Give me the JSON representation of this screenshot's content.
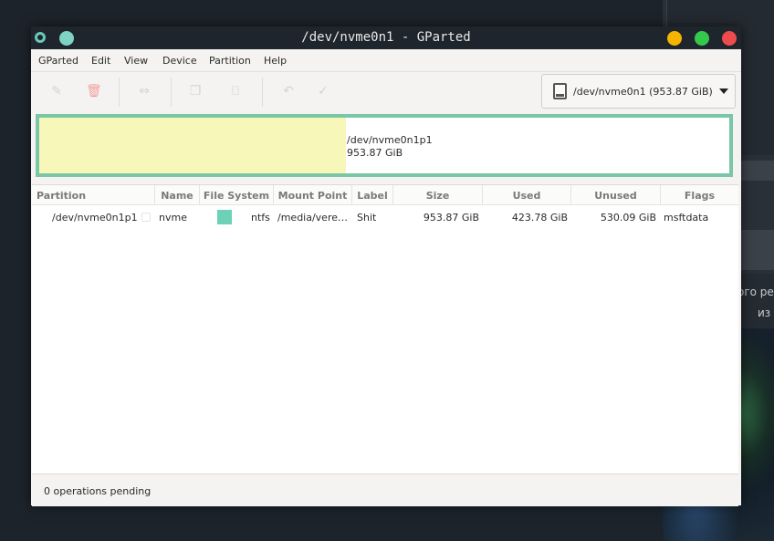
{
  "window": {
    "title": "/dev/nvme0n1 - GParted"
  },
  "menu": [
    "GParted",
    "Edit",
    "View",
    "Device",
    "Partition",
    "Help"
  ],
  "toolbar": {
    "icons": [
      "new-partition-icon",
      "delete-icon",
      "resize-move-icon",
      "copy-icon",
      "paste-icon",
      "undo-icon",
      "apply-icon"
    ],
    "device_selector": "/dev/nvme0n1 (953.87 GiB)"
  },
  "disk_visual": {
    "partition": "/dev/nvme0n1p1",
    "size": "953.87 GiB",
    "used_fraction": 0.444,
    "used_color": "#f7f7b9",
    "border_color": "#79c7a6"
  },
  "table": {
    "headers": [
      "Partition",
      "Name",
      "File System",
      "Mount Point",
      "Label",
      "Size",
      "Used",
      "Unused",
      "Flags"
    ],
    "rows": [
      {
        "partition": "/dev/nvme0n1p1",
        "name": "nvme",
        "fs_color": "#6cd1b6",
        "file_system": "ntfs",
        "mount_point": "/media/vere…",
        "label": "Shit",
        "size": "953.87 GiB",
        "used": "423.78 GiB",
        "unused": "530.09 GiB",
        "flags": "msftdata"
      }
    ]
  },
  "status": {
    "text": "0 operations pending"
  },
  "background": {
    "text_line1": "ого ре",
    "text_line2": "из"
  }
}
